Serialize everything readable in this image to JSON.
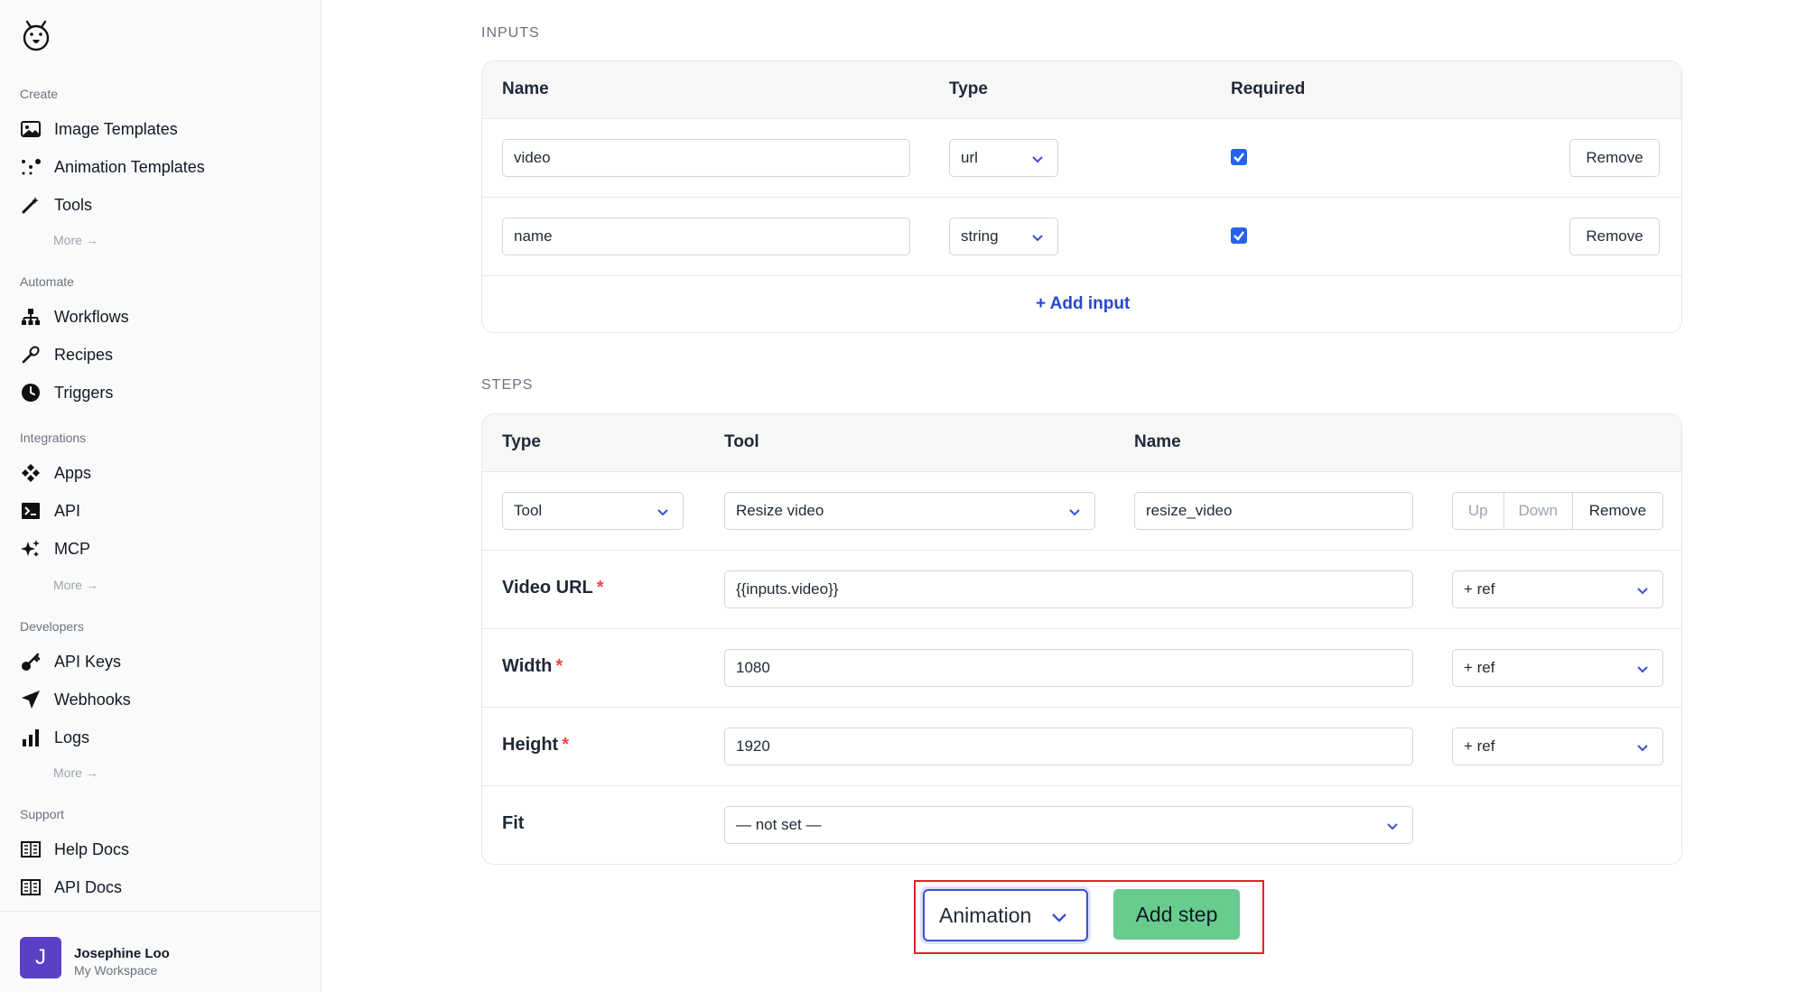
{
  "sidebar": {
    "sections": {
      "create": "Create",
      "automate": "Automate",
      "integrations": "Integrations",
      "developers": "Developers",
      "support": "Support"
    },
    "items": {
      "image_templates": "Image Templates",
      "animation_templates": "Animation Templates",
      "tools": "Tools",
      "workflows": "Workflows",
      "recipes": "Recipes",
      "triggers": "Triggers",
      "apps": "Apps",
      "api": "API",
      "mcp": "MCP",
      "api_keys": "API Keys",
      "webhooks": "Webhooks",
      "logs": "Logs",
      "help_docs": "Help Docs",
      "api_docs": "API Docs"
    },
    "more_label": "More →",
    "user": {
      "initial": "J",
      "name": "Josephine Loo",
      "workspace": "My Workspace"
    }
  },
  "inputs": {
    "title": "INPUTS",
    "headers": {
      "name": "Name",
      "type": "Type",
      "required": "Required"
    },
    "rows": [
      {
        "name": "video",
        "type": "url",
        "required": true,
        "remove": "Remove"
      },
      {
        "name": "name",
        "type": "string",
        "required": true,
        "remove": "Remove"
      }
    ],
    "add_label": "+ Add input"
  },
  "steps": {
    "title": "STEPS",
    "headers": {
      "type": "Type",
      "tool": "Tool",
      "name": "Name"
    },
    "step": {
      "type": "Tool",
      "tool": "Resize video",
      "name": "resize_video",
      "up": "Up",
      "down": "Down",
      "remove": "Remove"
    },
    "params": [
      {
        "label": "Video URL",
        "required_mark": "*",
        "value": "{{inputs.video}}",
        "ref": "+ ref"
      },
      {
        "label": "Width",
        "required_mark": "*",
        "value": "1080",
        "ref": "+ ref"
      },
      {
        "label": "Height",
        "required_mark": "*",
        "value": "1920",
        "ref": "+ ref"
      },
      {
        "label": "Fit",
        "value": "— not set —"
      }
    ]
  },
  "add_step": {
    "type_value": "Animation",
    "button_label": "Add step"
  }
}
